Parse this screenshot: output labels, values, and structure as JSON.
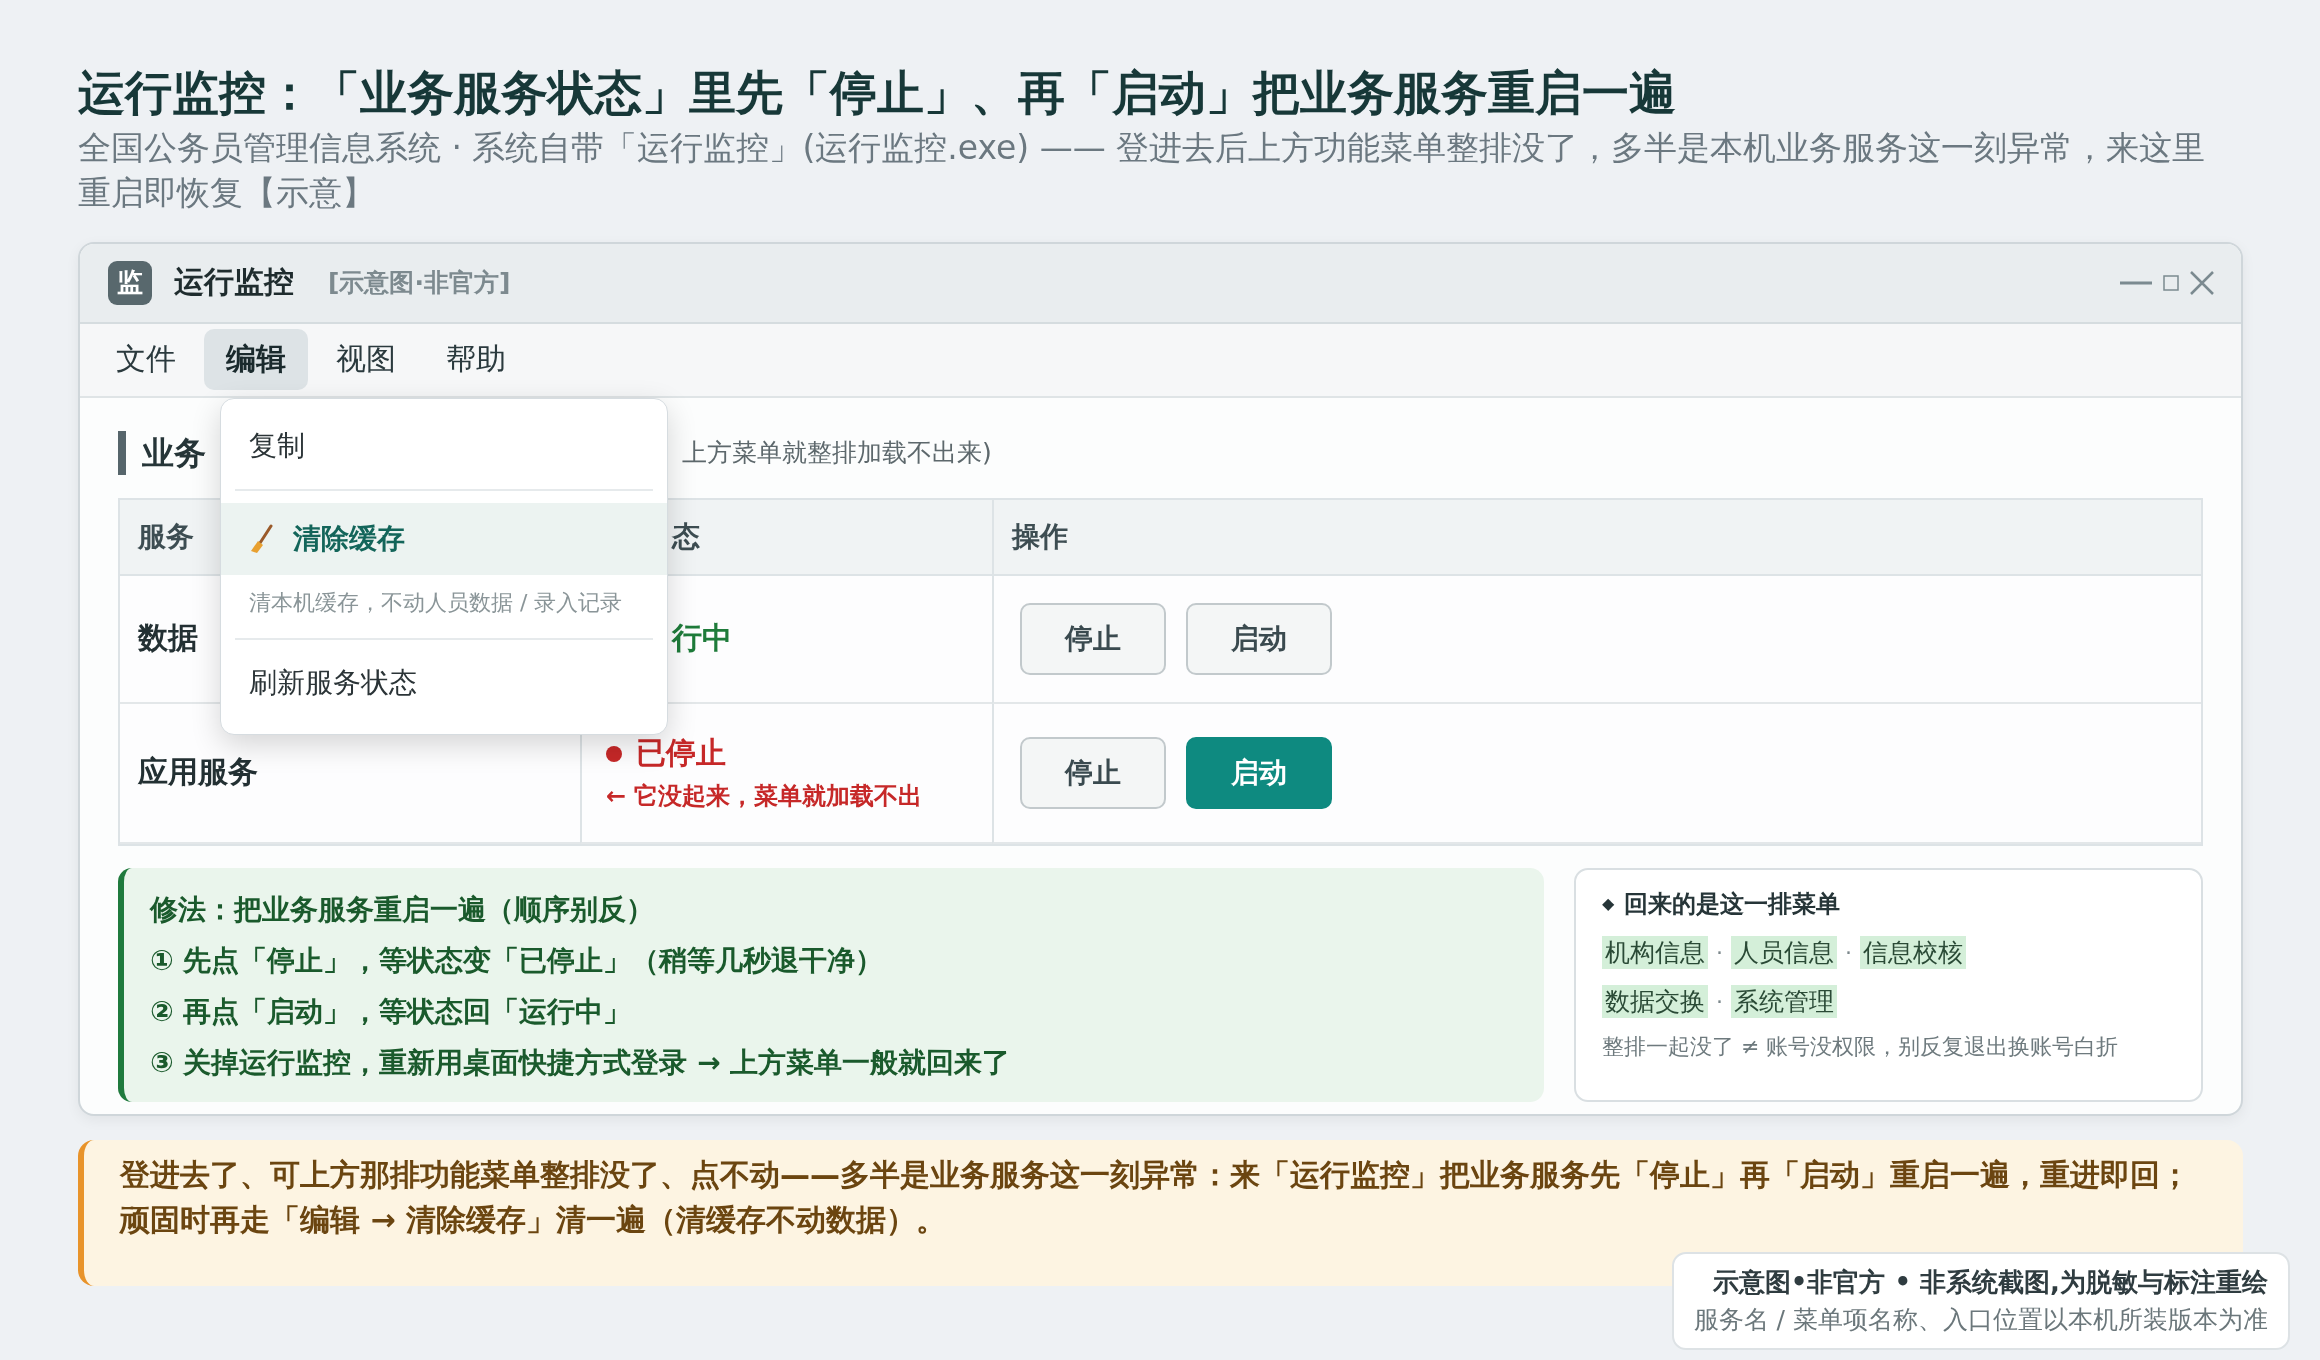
{
  "page": {
    "title": "运行监控：「业务服务状态」里先「停止」、再「启动」把业务服务重启一遍",
    "subtitle": "全国公务员管理信息系统 · 系统自带「运行监控」(运行监控.exe) —— 登进去后上方功能菜单整排没了，多半是本机业务服务这一刻异常，来这里重启即恢复【示意】"
  },
  "window": {
    "icon": "监",
    "title": "运行监控",
    "tag": "[示意图·非官方]"
  },
  "menu": [
    {
      "label": "文件",
      "selected": false
    },
    {
      "label": "编辑",
      "selected": true
    },
    {
      "label": "视图",
      "selected": false
    },
    {
      "label": "帮助",
      "selected": false
    }
  ],
  "dropdown": [
    {
      "label": "复制",
      "highlighted": false
    },
    {
      "label": "清除缓存",
      "highlighted": true,
      "description": "清本机缓存，不动人员数据 / 录入记录"
    },
    {
      "label": "刷新服务状态",
      "highlighted": false
    }
  ],
  "section": {
    "title": "业务",
    "note": "上方菜单就整排加载不出来)"
  },
  "table": {
    "columns": [
      "服务",
      "态",
      "操作"
    ],
    "rows": [
      {
        "name": "数据",
        "status": {
          "kind": "running",
          "label": "行中"
        },
        "buttons": [
          {
            "label": "停止",
            "primary": false
          },
          {
            "label": "启动",
            "primary": false
          }
        ]
      },
      {
        "name": "应用服务",
        "status": {
          "kind": "stopped",
          "label": "已停止",
          "note": "← 它没起来，菜单就加载不出"
        },
        "buttons": [
          {
            "label": "停止",
            "primary": false
          },
          {
            "label": "启动",
            "primary": true
          }
        ]
      }
    ]
  },
  "fix": {
    "title": "修法：把业务服务重启一遍（顺序别反）",
    "steps": [
      "① 先点「停止」，等状态变「已停止」（稍等几秒退干净）",
      "② 再点「启动」，等状态回「运行中」",
      "③ 关掉运行监控，重新用桌面快捷方式登录 → 上方菜单一般就回来了"
    ]
  },
  "menu_card": {
    "bullet": "◆",
    "title": "回来的是这一排菜单",
    "separator": "·",
    "rows": [
      [
        "机构信息",
        "人员信息",
        "信息校核"
      ],
      [
        "数据交换",
        "系统管理"
      ]
    ],
    "note": "整排一起没了 ≠ 账号没权限，别反复退出换账号白折"
  },
  "banner": {
    "text": "登进去了、可上方那排功能菜单整排没了、点不动——多半是业务服务这一刻异常：来「运行监控」把业务服务先「停止」再「启动」重启一遍，重进即回；顽固时再走「编辑 → 清除缓存」清一遍（清缓存不动数据）。"
  },
  "footnote": {
    "title": "示意图•非官方 • 非系统截图,为脱敏与标注重绘",
    "text": "服务名 / 菜单项名称、入口位置以本机所装版本为准"
  }
}
